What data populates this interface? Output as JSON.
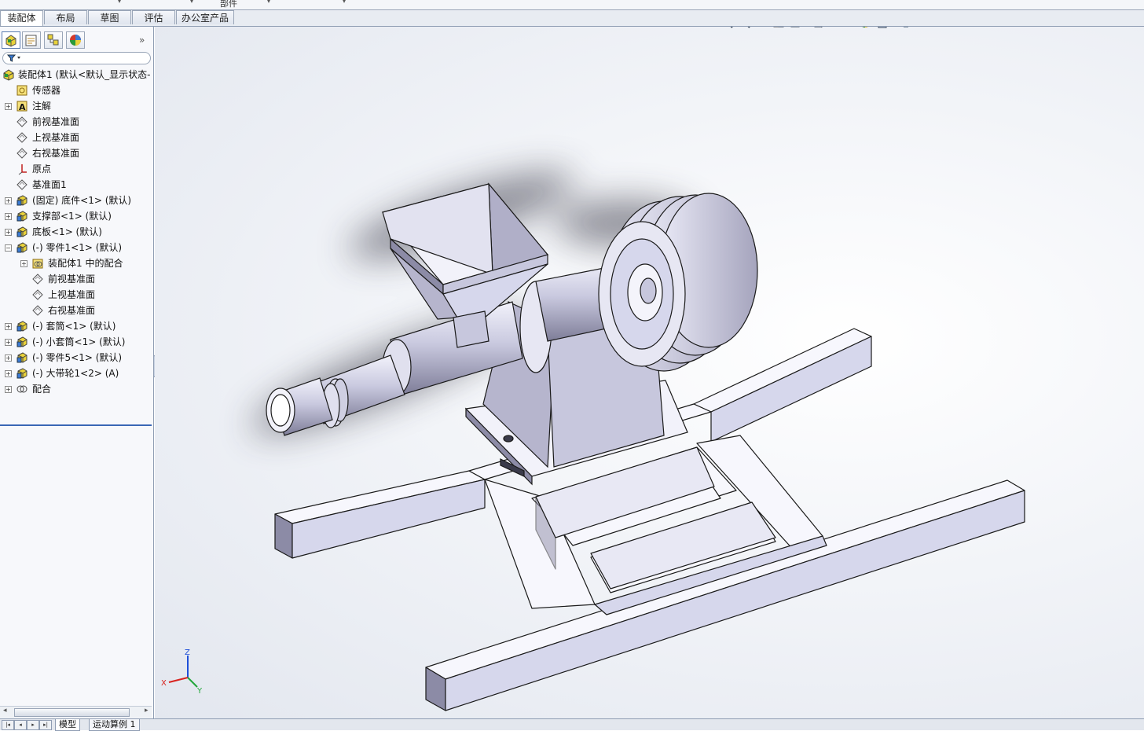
{
  "top_menu": {
    "visible_fragment": "部件"
  },
  "command_tabs": [
    {
      "label": "装配体",
      "active": true
    },
    {
      "label": "布局",
      "active": false
    },
    {
      "label": "草图",
      "active": false
    },
    {
      "label": "评估",
      "active": false
    },
    {
      "label": "办公室产品",
      "active": false
    }
  ],
  "panel_tabs": [
    {
      "icon": "feature-manager-icon"
    },
    {
      "icon": "property-manager-icon"
    },
    {
      "icon": "configuration-manager-icon"
    },
    {
      "icon": "display-manager-icon"
    }
  ],
  "panel_expand_glyph": "»",
  "feature_tree": {
    "root": "装配体1 (默认<默认_显示状态-",
    "items": [
      {
        "label": "传感器",
        "icon": "sensor-icon"
      },
      {
        "label": "注解",
        "icon": "annotation-icon"
      },
      {
        "label": "前视基准面",
        "icon": "plane-icon"
      },
      {
        "label": "上视基准面",
        "icon": "plane-icon"
      },
      {
        "label": "右视基准面",
        "icon": "plane-icon"
      },
      {
        "label": "原点",
        "icon": "origin-icon"
      },
      {
        "label": "基准面1",
        "icon": "plane-icon"
      },
      {
        "label": "(固定) 底件<1> (默认)",
        "icon": "part-icon"
      },
      {
        "label": "支撑部<1> (默认)",
        "icon": "part-icon"
      },
      {
        "label": "底板<1> (默认)",
        "icon": "part-icon"
      },
      {
        "label": "(-) 零件1<1> (默认)",
        "icon": "part-icon"
      },
      {
        "label": "装配体1 中的配合",
        "icon": "mates-folder-icon"
      },
      {
        "label": "前视基准面",
        "icon": "plane-icon"
      },
      {
        "label": "上视基准面",
        "icon": "plane-icon"
      },
      {
        "label": "右视基准面",
        "icon": "plane-icon"
      },
      {
        "label": "(-) 套筒<1> (默认)",
        "icon": "part-icon"
      },
      {
        "label": "(-) 小套筒<1> (默认)",
        "icon": "part-icon"
      },
      {
        "label": "(-) 零件5<1> (默认)",
        "icon": "part-icon"
      },
      {
        "label": "(-) 大带轮1<2> (A)",
        "icon": "part-icon"
      },
      {
        "label": "配合",
        "icon": "mates-icon"
      }
    ]
  },
  "bottom_tabs": [
    {
      "label": "模型",
      "active": true
    },
    {
      "label": "运动算例 1",
      "active": false
    }
  ],
  "view_toolbar_icons": [
    "zoom-to-fit-icon",
    "zoom-to-area-icon",
    "previous-view-icon",
    "section-view-icon",
    "view-orientation-icon",
    "display-style-icon",
    "hide-show-items-icon",
    "edit-appearance-icon",
    "apply-scene-icon",
    "view-settings-icon"
  ],
  "triad_axes": {
    "x": "X",
    "y": "Y",
    "z": "Z"
  },
  "colors": {
    "model_fill": "#d6d7ec",
    "model_shade": "#8c8ba6",
    "model_edge": "#1a1a1a",
    "tab_border": "#9aa6b8",
    "tree_selection_line": "#3a67b5"
  }
}
